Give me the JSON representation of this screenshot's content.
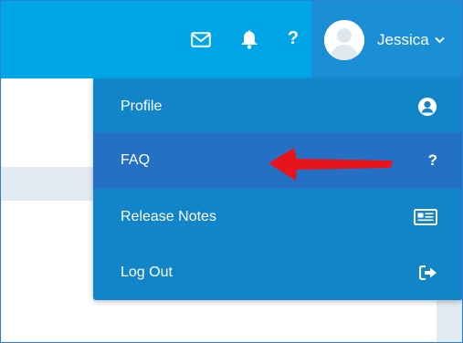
{
  "header": {
    "icons": [
      "mail-icon",
      "bell-icon",
      "help-icon"
    ],
    "help_glyph": "?",
    "user": {
      "name": "Jessica",
      "avatar": "default-user-avatar"
    }
  },
  "menu": {
    "items": [
      {
        "label": "Profile",
        "icon": "user-circle-icon"
      },
      {
        "label": "FAQ",
        "icon": "question-icon",
        "icon_glyph": "?"
      },
      {
        "label": "Release Notes",
        "icon": "newspaper-icon"
      },
      {
        "label": "Log Out",
        "icon": "sign-out-icon"
      }
    ],
    "highlighted_item": "FAQ"
  },
  "annotation": {
    "type": "red-arrow",
    "points_to": "FAQ",
    "color": "#e8141b"
  },
  "colors": {
    "topbar": "#00a6e8",
    "user_area": "#1b8fd6",
    "menu_bg": "#1185c8",
    "menu_active": "#2470c4"
  }
}
